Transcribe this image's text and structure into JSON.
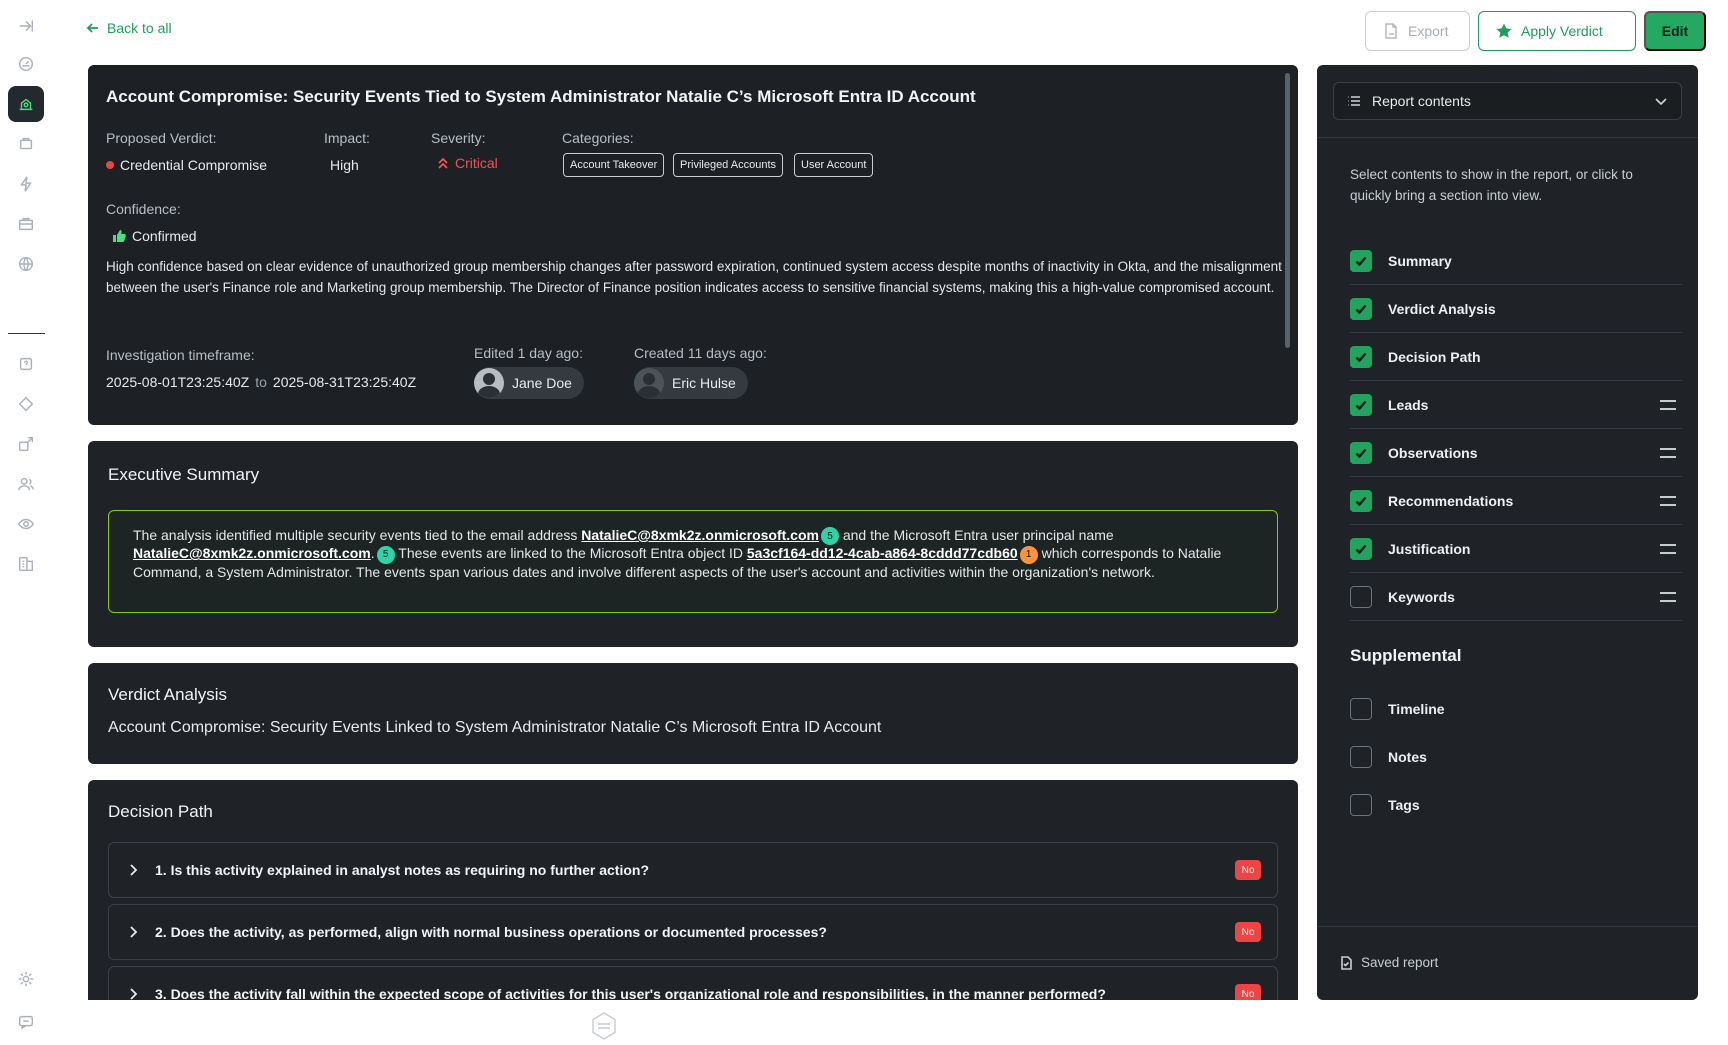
{
  "nav": {
    "back_label": "Back to all"
  },
  "toolbar": {
    "export_label": "Export",
    "apply_label": "Apply Verdict",
    "edit_label": "Edit"
  },
  "report": {
    "title": "Account Compromise: Security Events Tied to System Administrator Natalie C’s Microsoft Entra ID Account",
    "proposed_verdict_label": "Proposed Verdict:",
    "proposed_verdict": "Credential Compromise",
    "impact_label": "Impact:",
    "impact": "High",
    "severity_label": "Severity:",
    "severity": "Critical",
    "categories_label": "Categories:",
    "categories": [
      "Account Takeover",
      "Privileged Accounts",
      "User Account"
    ],
    "confidence_label": "Confidence:",
    "confidence": "Confirmed",
    "confidence_text": "High confidence based on clear evidence of unauthorized group membership changes after password expiration, continued system access despite months of inactivity in Okta, and the misalignment between the user's Finance role and Marketing group membership. The Director of Finance position indicates access to sensitive financial systems, making this a high-value compromised account.",
    "timeframe_label": "Investigation timeframe:",
    "timeframe_start": "2025-08-01T23:25:40Z",
    "timeframe_to": "to",
    "timeframe_end": "2025-08-31T23:25:40Z",
    "edited_label": "Edited 1 day ago:",
    "edited_by": "Jane Doe",
    "created_label": "Created 11 days ago:",
    "created_by": "Eric Hulse"
  },
  "exec_summary": {
    "title": "Executive Summary",
    "p1": "The analysis identified multiple security events tied to the email address ",
    "email": "NatalieC@8xmk2z.onmicrosoft.com",
    "badge1": "5",
    "p2": " and the Microsoft Entra user principal name ",
    "upn": "NatalieC@8xmk2z.onmicrosoft.com",
    "p2b": ".",
    "badge2": "5",
    "p3": " These events are linked to the Microsoft Entra object ID ",
    "object_id": "5a3cf164-dd12-4cab-a864-8cddd77cdb60",
    "badge3": "1",
    "p4": " which corresponds to Natalie Command, a System Administrator. The events span various dates and involve different aspects of the user's account and activities within the organization's network."
  },
  "verdict_analysis": {
    "title": "Verdict Analysis",
    "text": "Account Compromise: Security Events Linked to System Administrator Natalie C’s Microsoft Entra ID Account"
  },
  "decision_path": {
    "title": "Decision Path",
    "items": [
      {
        "question": "1. Is this activity explained in analyst notes as requiring no further action?",
        "answer": "No"
      },
      {
        "question": "2. Does the activity, as performed, align with normal business operations or documented processes?",
        "answer": "No"
      },
      {
        "question": "3. Does the activity fall within the expected scope of activities for this user's organizational role and responsibilities, in the manner performed?",
        "answer": "No"
      }
    ]
  },
  "sidebar": {
    "select_label": "Report contents",
    "help_text": "Select contents to show in the report, or click to quickly bring a section into view.",
    "items": [
      {
        "label": "Summary",
        "checked": true
      },
      {
        "label": "Verdict Analysis",
        "checked": true
      },
      {
        "label": "Decision Path",
        "checked": true
      },
      {
        "label": "Leads",
        "checked": true
      },
      {
        "label": "Observations",
        "checked": true
      },
      {
        "label": "Recommendations",
        "checked": true
      },
      {
        "label": "Justification",
        "checked": true
      },
      {
        "label": "Keywords",
        "checked": false
      }
    ],
    "supplemental_title": "Supplemental",
    "supplemental": [
      {
        "label": "Timeline",
        "checked": false
      },
      {
        "label": "Notes",
        "checked": false
      },
      {
        "label": "Tags",
        "checked": false
      }
    ],
    "saved_label": "Saved report"
  },
  "colors": {
    "accent": "#25a862",
    "critical": "#f05252",
    "summary_border": "#84cc16"
  }
}
